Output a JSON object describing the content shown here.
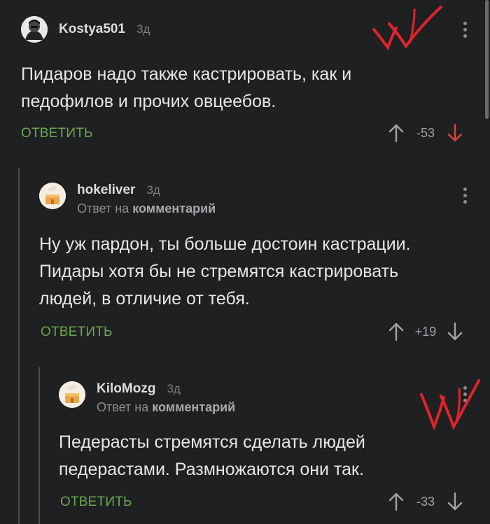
{
  "comments": [
    {
      "username": "Kostya501",
      "time": "3д",
      "text_lines": [
        "Пидаров надо также кастрировать, как и",
        "педофилов и прочих овцеебов."
      ],
      "reply_label": "ОТВЕТИТЬ",
      "score": "-53",
      "vote_state": "down"
    },
    {
      "username": "hokeliver",
      "time": "3д",
      "reply_prefix": "Ответ на",
      "reply_target": "комментарий",
      "text_lines": [
        "Ну уж пардон, ты больше достоин кастрации.",
        "Пидары хотя бы не стремятся кастрировать",
        "людей, в отличие от тебя."
      ],
      "reply_label": "ОТВЕТИТЬ",
      "score": "+19",
      "vote_state": "none"
    },
    {
      "username": "KiloMozg",
      "time": "3д",
      "reply_prefix": "Ответ на",
      "reply_target": "комментарий",
      "text_lines": [
        "Педерасты стремятся сделать людей",
        "педерастами. Размножаются они так."
      ],
      "reply_label": "ОТВЕТИТЬ",
      "score": "-33",
      "vote_state": "none"
    }
  ],
  "colors": {
    "background": "#1f2022",
    "reply_button": "#6aa84f",
    "downvote_active": "#d9443a",
    "annotation_mark": "#e0242a"
  },
  "icons": [
    "more-vertical-icon",
    "upvote-arrow-icon",
    "downvote-arrow-icon",
    "default-avatar-icon"
  ]
}
